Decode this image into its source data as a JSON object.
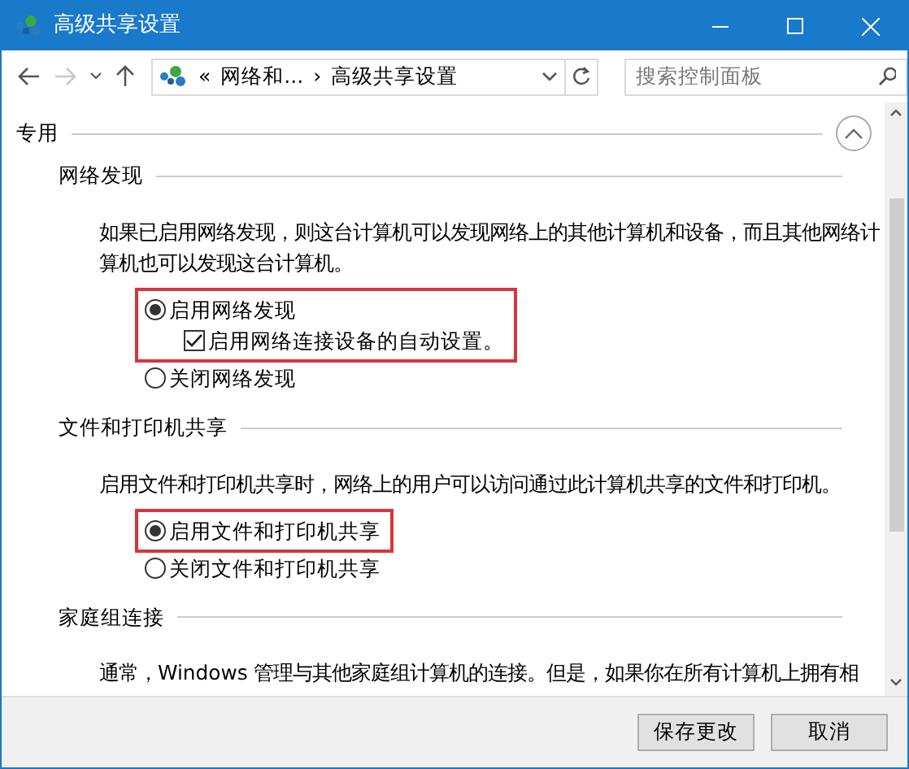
{
  "window": {
    "title": "高级共享设置"
  },
  "address_bar": {
    "breadcrumbs": [
      "«",
      "网络和...",
      "›",
      "高级共享设置"
    ]
  },
  "search": {
    "placeholder": "搜索控制面板"
  },
  "profile": {
    "title": "专用",
    "expanded": true
  },
  "sections": [
    {
      "title": "网络发现",
      "description": "如果已启用网络发现，则这台计算机可以发现网络上的其他计算机和设备，而且其他网络计算机也可以发现这台计算机。",
      "options": [
        {
          "label": "启用网络发现",
          "selected": true,
          "highlighted": true,
          "sub_option": {
            "label": "启用网络连接设备的自动设置。",
            "checked": true
          }
        },
        {
          "label": "关闭网络发现",
          "selected": false,
          "highlighted": false
        }
      ]
    },
    {
      "title": "文件和打印机共享",
      "description": "启用文件和打印机共享时，网络上的用户可以访问通过此计算机共享的文件和打印机。",
      "options": [
        {
          "label": "启用文件和打印机共享",
          "selected": true,
          "highlighted": true
        },
        {
          "label": "关闭文件和打印机共享",
          "selected": false,
          "highlighted": false
        }
      ]
    },
    {
      "title": "家庭组连接",
      "description": "通常，Windows 管理与其他家庭组计算机的连接。但是，如果你在所有计算机上拥有相"
    }
  ],
  "buttons": [
    "保存更改",
    "取消"
  ]
}
